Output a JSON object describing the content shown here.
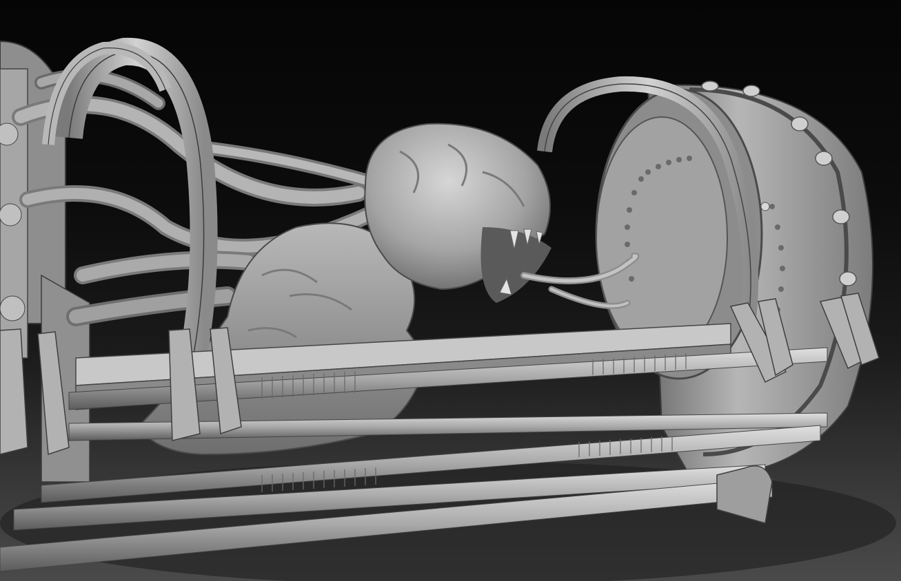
{
  "scene": {
    "description": "",
    "engraving_text": "",
    "colors": {
      "background_top": "#050505",
      "background_bottom": "#4a4a4a",
      "material_light": "#cfcfcf",
      "material_mid": "#9a9a9a",
      "material_dark": "#5a5a5a"
    }
  }
}
